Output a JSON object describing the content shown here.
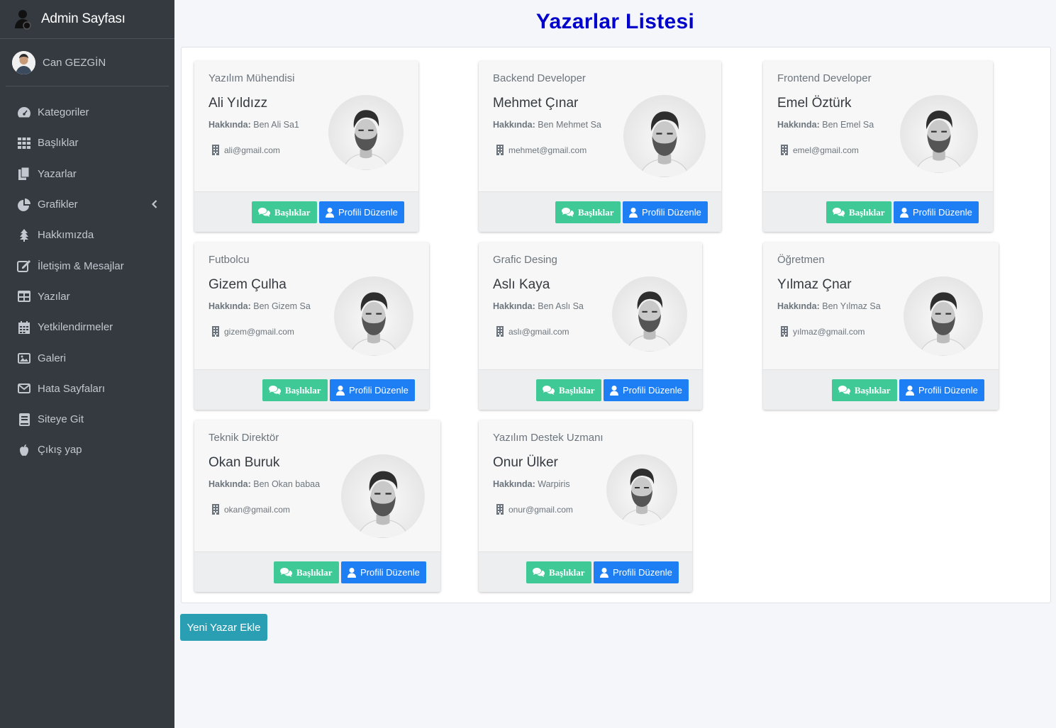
{
  "sidebar": {
    "brand": "Admin Sayfası",
    "user_name": "Can GEZGİN",
    "items": [
      {
        "label": "Kategoriler",
        "icon": "dashboard-icon"
      },
      {
        "label": "Başlıklar",
        "icon": "grid-icon"
      },
      {
        "label": "Yazarlar",
        "icon": "copy-icon"
      },
      {
        "label": "Grafikler",
        "icon": "pie-chart-icon"
      },
      {
        "label": "Hakkımızda",
        "icon": "tree-icon"
      },
      {
        "label": "İletişim & Mesajlar",
        "icon": "edit-icon"
      },
      {
        "label": "Yazılar",
        "icon": "table-icon"
      },
      {
        "label": "Yetkilendirmeler",
        "icon": "calendar-icon"
      },
      {
        "label": "Galeri",
        "icon": "image-icon"
      },
      {
        "label": "Hata Sayfaları",
        "icon": "envelope-icon"
      },
      {
        "label": "Siteye Git",
        "icon": "book-icon"
      },
      {
        "label": "Çıkış yap",
        "icon": "apple-icon"
      }
    ]
  },
  "page": {
    "title": "Yazarlar Listesi",
    "add_button": "Yeni Yazar Ekle"
  },
  "labels": {
    "about_prefix": "Hakkında:",
    "titles_button": "Başlıklar",
    "edit_button": "Profili Düzenle"
  },
  "writers": [
    {
      "role": "Yazılım Mühendisi",
      "name": "Ali Yıldızz",
      "about": "Ben Ali Sa1",
      "email": "ali@gmail.com"
    },
    {
      "role": "Backend Developer",
      "name": "Mehmet Çınar",
      "about": "Ben Mehmet Sa",
      "email": "mehmet@gmail.com"
    },
    {
      "role": "Frontend Developer",
      "name": "Emel Öztürk",
      "about": "Ben Emel Sa",
      "email": "emel@gmail.com"
    },
    {
      "role": "Futbolcu",
      "name": "Gizem Çulha",
      "about": "Ben Gizem Sa",
      "email": "gizem@gmail.com"
    },
    {
      "role": "Grafic Desing",
      "name": "Aslı Kaya",
      "about": "Ben Aslı Sa",
      "email": "aslı@gmail.com"
    },
    {
      "role": "Öğretmen",
      "name": "Yılmaz Çnar",
      "about": "Ben Yılmaz Sa",
      "email": "yılmaz@gmail.com"
    },
    {
      "role": "Teknik Direktör",
      "name": "Okan Buruk",
      "about": "Ben Okan babaa",
      "email": "okan@gmail.com"
    },
    {
      "role": "Yazılım Destek Uzmanı",
      "name": "Onur Ülker",
      "about": "Warpiris",
      "email": "onur@gmail.com"
    }
  ],
  "colors": {
    "sidebar_bg": "#343a40",
    "title": "#0000cc",
    "green_button": "#3ec996",
    "blue_button": "#1e7ff5",
    "add_button": "#2a9eb3"
  }
}
